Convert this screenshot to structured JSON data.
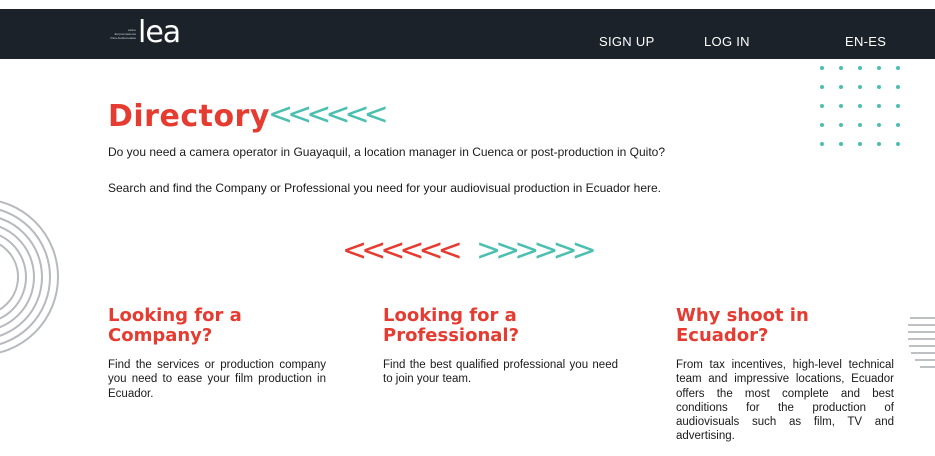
{
  "header": {
    "logo": {
      "word": "lea",
      "tagline": "Latino Emprendedores Para Audiovisuales"
    },
    "nav": [
      {
        "label": "SIGN UP"
      },
      {
        "label": "LOG IN"
      },
      {
        "label": "EN-ES"
      }
    ]
  },
  "main": {
    "title": "Directory",
    "chevrons_left": "<<<<<<",
    "chevrons_right": ">>>>>>",
    "intro_1": "Do you need a camera operator in Guayaquil, a location manager in Cuenca or post-production in Quito?",
    "intro_2": "Search and find the Company or Professional you need for your audiovisual production in Ecuador here."
  },
  "columns": [
    {
      "title_line1": "Looking for a",
      "title_line2": "Company?",
      "text": "Find the services or production company you need to ease your film production in Ecuador."
    },
    {
      "title_line1": "Looking for a",
      "title_line2": "Professional?",
      "text": "Find the best qualified professional you need to join your team."
    },
    {
      "title_line1": "Why shoot in",
      "title_line2": "Ecuador?",
      "text": "From tax incentives, high-level technical team and impressive locations, Ecuador offers the most complete and best conditions for the production of audiovisuals such as film, TV and advertising."
    }
  ],
  "colors": {
    "accent_red": "#e53b30",
    "accent_teal": "#4bbfb0",
    "header_bg": "#1b2229"
  }
}
